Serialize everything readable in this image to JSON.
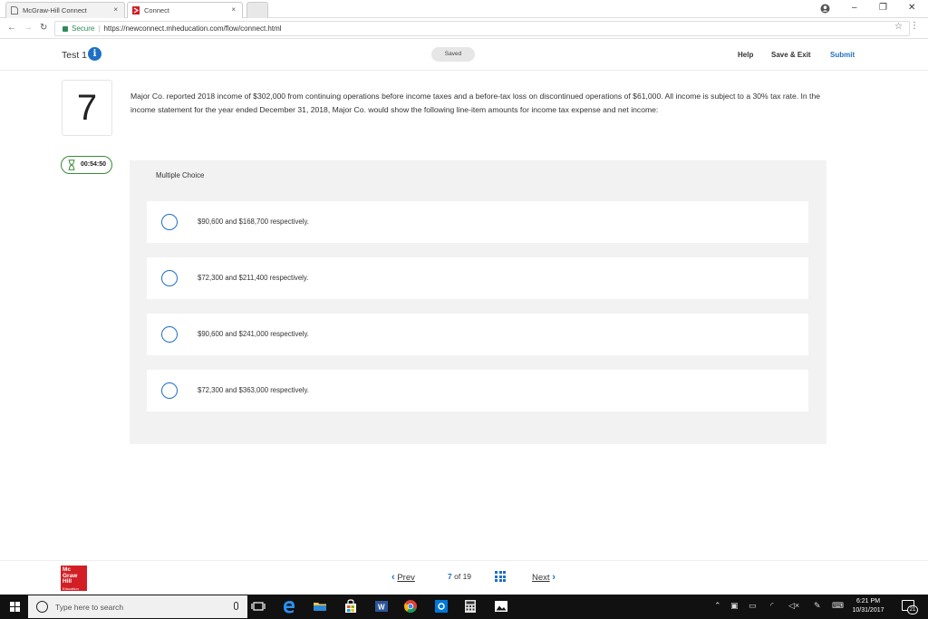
{
  "browser": {
    "tabs": [
      {
        "title": "McGraw-Hill Connect",
        "active": false
      },
      {
        "title": "Connect",
        "active": true
      }
    ],
    "secure_label": "Secure",
    "url": "https://newconnect.mheducation.com/flow/connect.html"
  },
  "header": {
    "test_title": "Test 1",
    "saved_label": "Saved",
    "help_label": "Help",
    "save_exit_label": "Save & Exit",
    "submit_label": "Submit"
  },
  "question": {
    "number": "7",
    "text": "Major Co. reported 2018 income of $302,000 from continuing operations before income taxes and a before-tax loss on discontinued operations of $61,000. All income is subject to a 30% tax rate. In the income statement for the year ended December 31, 2018, Major Co. would show the following line-item amounts for income tax expense and net income:",
    "timer": "00:54:50",
    "type_label": "Multiple Choice",
    "options": [
      {
        "text": "$90,600 and $168,700 respectively.",
        "selected": false
      },
      {
        "text": "$72,300 and $211,400 respectively.",
        "selected": false
      },
      {
        "text": "$90,600 and $241,000 respectively.",
        "selected": false
      },
      {
        "text": "$72,300 and $363,000 respectively.",
        "selected": false
      }
    ]
  },
  "footer": {
    "logo_lines": [
      "Mc",
      "Graw",
      "Hill",
      "Education"
    ],
    "prev_label": "Prev",
    "current_page": "7",
    "of_label": "of",
    "total_pages": "19",
    "next_label": "Next"
  },
  "taskbar": {
    "search_placeholder": "Type here to search",
    "time": "6:21 PM",
    "date": "10/31/2017",
    "notification_count": "21"
  },
  "colors": {
    "accent": "#1f6fc5",
    "timer_border": "#3a8a3a",
    "brand_red": "#d21f26",
    "panel_bg": "#f2f2f2"
  }
}
